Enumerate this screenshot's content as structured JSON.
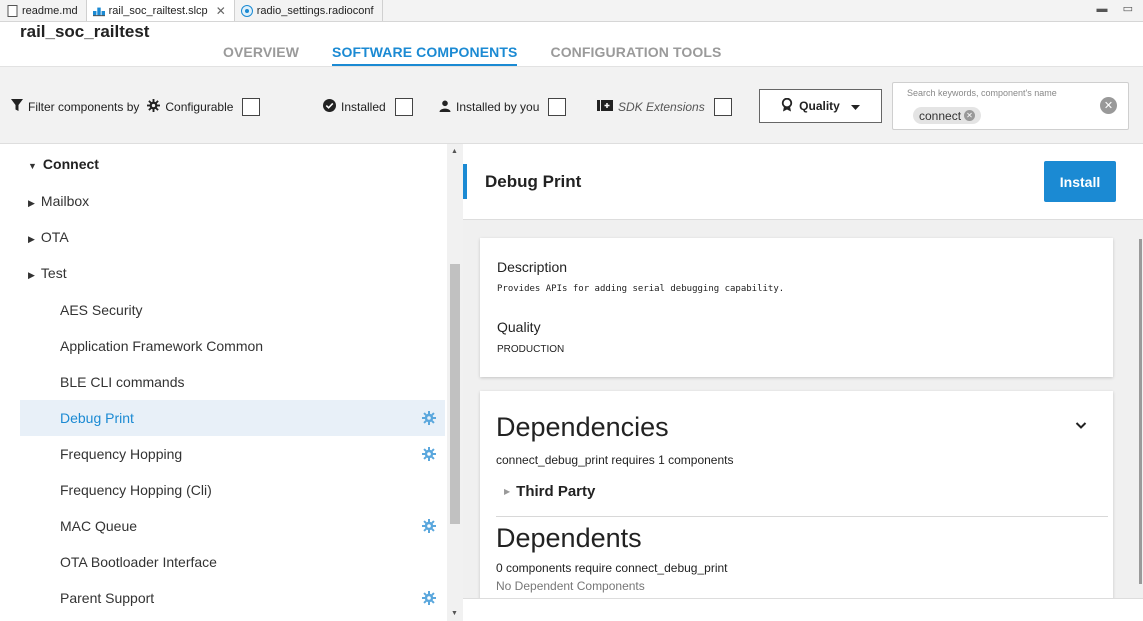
{
  "editor_tabs": [
    {
      "label": "readme.md",
      "icon": "file-icon",
      "active": false
    },
    {
      "label": "rail_soc_railtest.slcp",
      "icon": "project-icon",
      "active": true
    },
    {
      "label": "radio_settings.radioconf",
      "icon": "radio-icon",
      "active": false
    }
  ],
  "header": {
    "project_name": "rail_soc_railtest",
    "tabs": [
      "OVERVIEW",
      "SOFTWARE COMPONENTS",
      "CONFIGURATION TOOLS"
    ],
    "active_tab": "SOFTWARE COMPONENTS"
  },
  "filters": {
    "prefix_label": "Filter components by",
    "configurable": "Configurable",
    "installed": "Installed",
    "installed_by_you": "Installed by you",
    "sdk_extensions": "SDK Extensions",
    "quality_button": "Quality",
    "search": {
      "placeholder": "Search keywords, component's name",
      "chip": "connect"
    }
  },
  "tree": {
    "root": "Connect",
    "groups": [
      "Mailbox",
      "OTA",
      "Test"
    ],
    "items": [
      {
        "label": "AES Security",
        "gear": false
      },
      {
        "label": "Application Framework Common",
        "gear": false
      },
      {
        "label": "BLE CLI commands",
        "gear": false
      },
      {
        "label": "Debug Print",
        "gear": true,
        "selected": true
      },
      {
        "label": "Frequency Hopping",
        "gear": true
      },
      {
        "label": "Frequency Hopping (Cli)",
        "gear": false
      },
      {
        "label": "MAC Queue",
        "gear": true
      },
      {
        "label": "OTA Bootloader Interface",
        "gear": false
      },
      {
        "label": "Parent Support",
        "gear": true
      }
    ]
  },
  "detail": {
    "title": "Debug Print",
    "install_label": "Install",
    "description_label": "Description",
    "description_text": "Provides APIs for adding serial debugging capability.",
    "quality_label": "Quality",
    "quality_value": "PRODUCTION",
    "dependencies_heading": "Dependencies",
    "dependencies_summary": "connect_debug_print requires 1 components",
    "dependency_group": "Third Party",
    "dependents_heading": "Dependents",
    "dependents_summary": "0 components require connect_debug_print",
    "dependents_empty": "No Dependent Components"
  },
  "colors": {
    "accent": "#1b8ad3",
    "gear": "#5aa7dd"
  }
}
